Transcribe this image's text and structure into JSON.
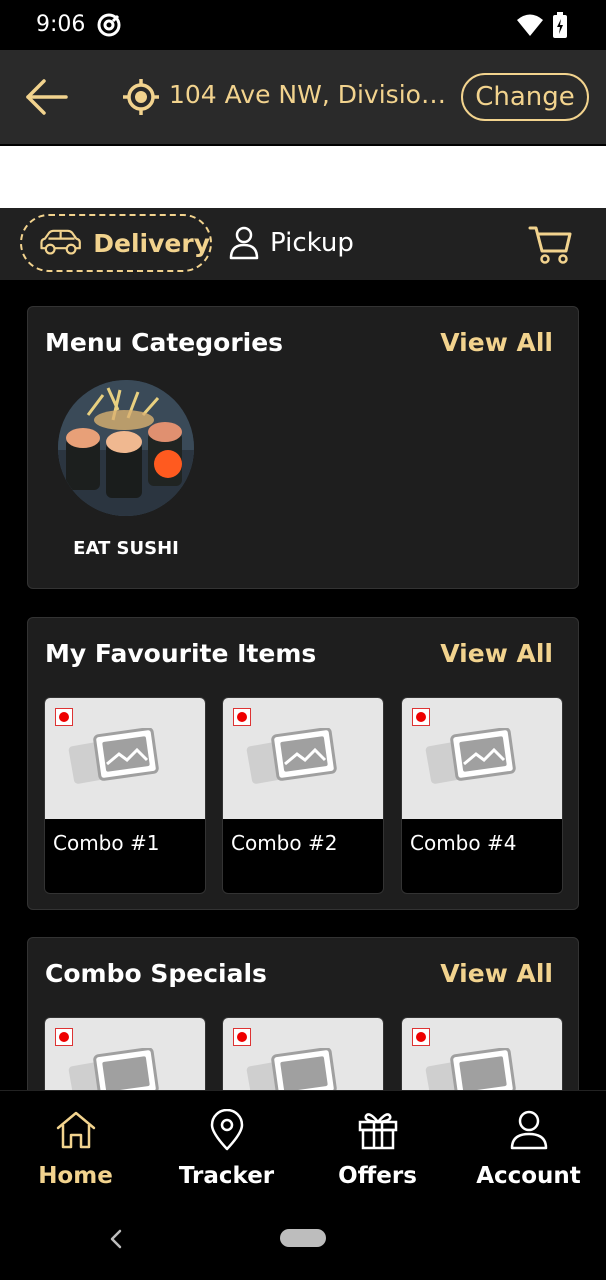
{
  "status_bar": {
    "time": "9:06"
  },
  "header": {
    "address": "104 Ave NW, Division...",
    "change_label": "Change"
  },
  "mode": {
    "delivery_label": "Delivery",
    "pickup_label": "Pickup"
  },
  "menu_categories": {
    "title": "Menu Categories",
    "view_all": "View All",
    "items": [
      {
        "label": "EAT SUSHI"
      }
    ]
  },
  "favourites": {
    "title": "My Favourite Items",
    "view_all": "View All",
    "items": [
      {
        "name": "Combo #1"
      },
      {
        "name": "Combo #2"
      },
      {
        "name": "Combo #4"
      }
    ]
  },
  "combo_specials": {
    "title": "Combo Specials",
    "view_all": "View All"
  },
  "bottom_nav": [
    {
      "label": "Home",
      "icon": "home-icon",
      "active": true
    },
    {
      "label": "Tracker",
      "icon": "location-pin-icon",
      "active": false
    },
    {
      "label": "Offers",
      "icon": "gift-icon",
      "active": false
    },
    {
      "label": "Account",
      "icon": "user-icon",
      "active": false
    }
  ],
  "colors": {
    "accent": "#f2d38e",
    "background": "#000000",
    "card": "#1e1e1e",
    "header": "#2a2a2a"
  }
}
